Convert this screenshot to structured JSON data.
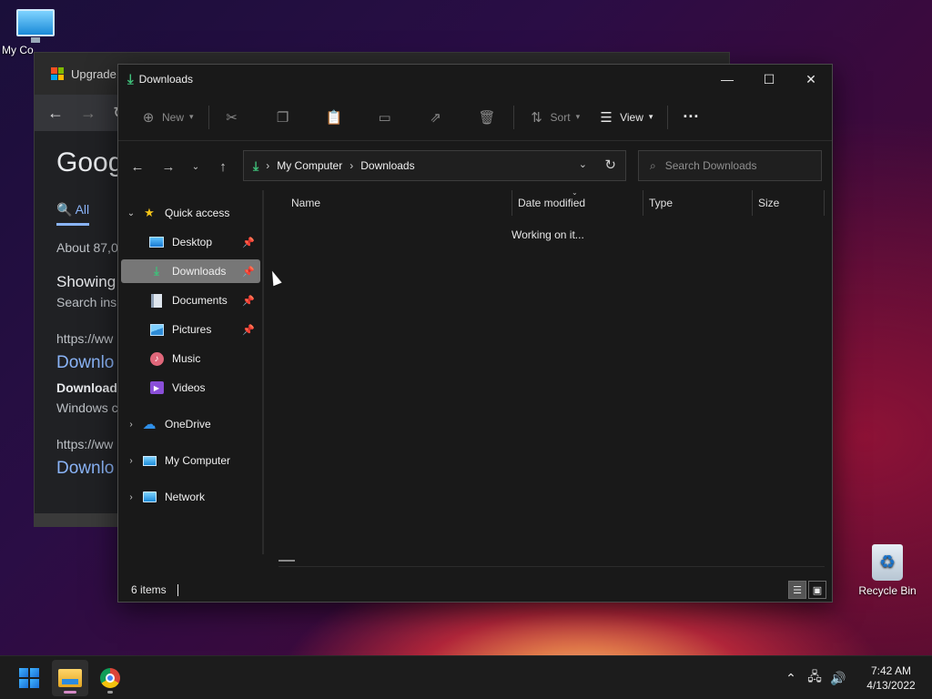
{
  "desktop": {
    "my_computer_label": "My Co",
    "recycle_bin_label": "Recycle Bin"
  },
  "browser": {
    "tab_title": "Upgrade",
    "google_text": "Goog",
    "tab_all": "All",
    "about_text": "About 87,0",
    "showing": "Showing",
    "search_ins": "Search ins",
    "url1": "https://ww",
    "link1": "Downlo",
    "bold1": "Download",
    "desc1": "Windows c",
    "url2": "https://ww",
    "link2": "Downlo"
  },
  "explorer": {
    "title": "Downloads",
    "toolbar": {
      "new_label": "New",
      "sort_label": "Sort",
      "view_label": "View"
    },
    "address": {
      "crumbs": [
        "My Computer",
        "Downloads"
      ],
      "search_placeholder": "Search Downloads"
    },
    "nav": {
      "quick_access": "Quick access",
      "items": [
        {
          "label": "Desktop",
          "pinned": true
        },
        {
          "label": "Downloads",
          "pinned": true
        },
        {
          "label": "Documents",
          "pinned": true
        },
        {
          "label": "Pictures",
          "pinned": true
        },
        {
          "label": "Music",
          "pinned": false
        },
        {
          "label": "Videos",
          "pinned": false
        }
      ],
      "onedrive": "OneDrive",
      "my_computer": "My Computer",
      "network": "Network"
    },
    "columns": [
      "Name",
      "Date modified",
      "Type",
      "Size"
    ],
    "loading_text": "Working on it...",
    "status_items": "6 items"
  },
  "taskbar": {
    "time": "7:42 AM",
    "date": "4/13/2022"
  },
  "colors": {
    "accent": "#3fc07a",
    "selection": "#777777",
    "window_bg": "#191919"
  }
}
